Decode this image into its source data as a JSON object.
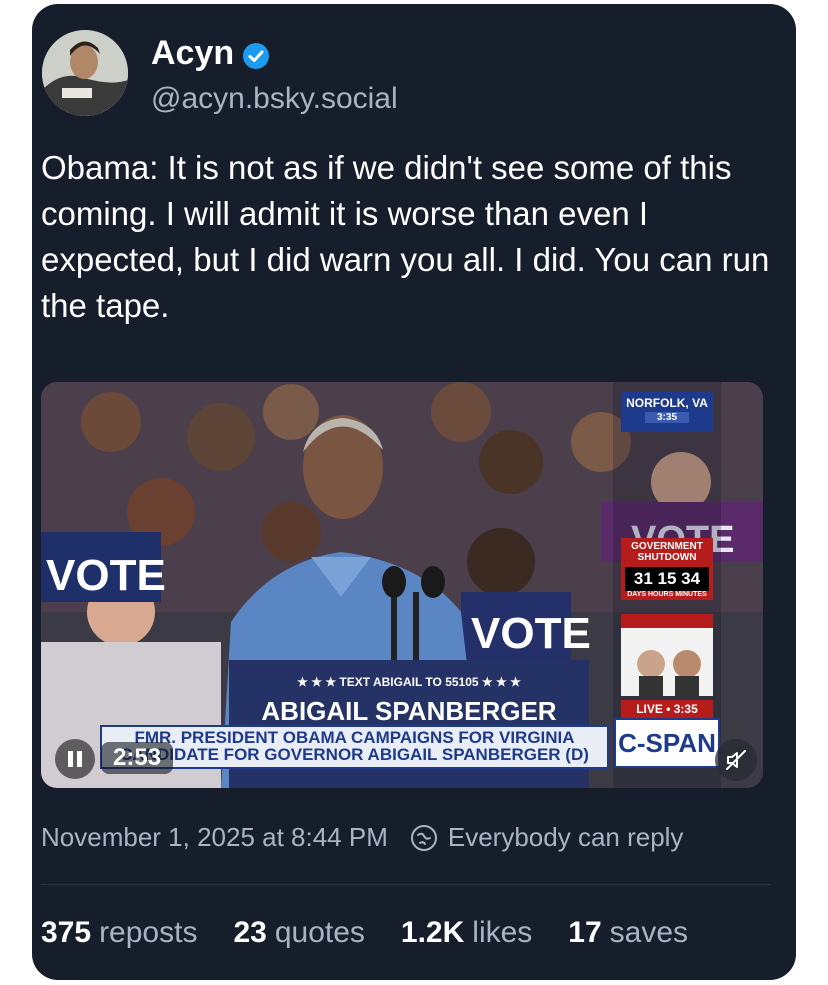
{
  "author": {
    "display_name": "Acyn",
    "handle": "@acyn.bsky.social",
    "verified_color": "#1d9bf0"
  },
  "post": {
    "text": "Obama: It is not as if we didn't see some of this coming. I will admit it is worse than even I expected, but I did warn you all. I did. You can run the tape."
  },
  "video": {
    "time": "2:53",
    "overlay": {
      "location": "NORFOLK, VA",
      "location_time": "3:35",
      "shutdown_title": "GOVERNMENT SHUTDOWN",
      "shutdown_count": "31 15 34",
      "shutdown_units": "DAYS HOURS MINUTES",
      "live_label": "LIVE • 3:35",
      "network": "C-SPAN",
      "podium_text": "★ ★ ★  TEXT ABIGAIL TO 55105  ★ ★ ★",
      "podium_name": "ABIGAIL SPANBERGER",
      "chyron_line1": "FMR. PRESIDENT OBAMA CAMPAIGNS FOR VIRGINIA",
      "chyron_line2": "CANDIDATE FOR GOVERNOR ABIGAIL SPANBERGER (D)",
      "sign_vote": "VOTE"
    }
  },
  "meta": {
    "timestamp": "November 1, 2025 at 8:44 PM",
    "reply_setting": "Everybody can reply"
  },
  "stats": {
    "reposts_count": "375",
    "reposts_label": "reposts",
    "quotes_count": "23",
    "quotes_label": "quotes",
    "likes_count": "1.2K",
    "likes_label": "likes",
    "saves_count": "17",
    "saves_label": "saves"
  },
  "colors": {
    "card_bg": "#161e2b",
    "secondary_text": "#a9b4c3",
    "cspan_blue": "#1e3a8c"
  }
}
